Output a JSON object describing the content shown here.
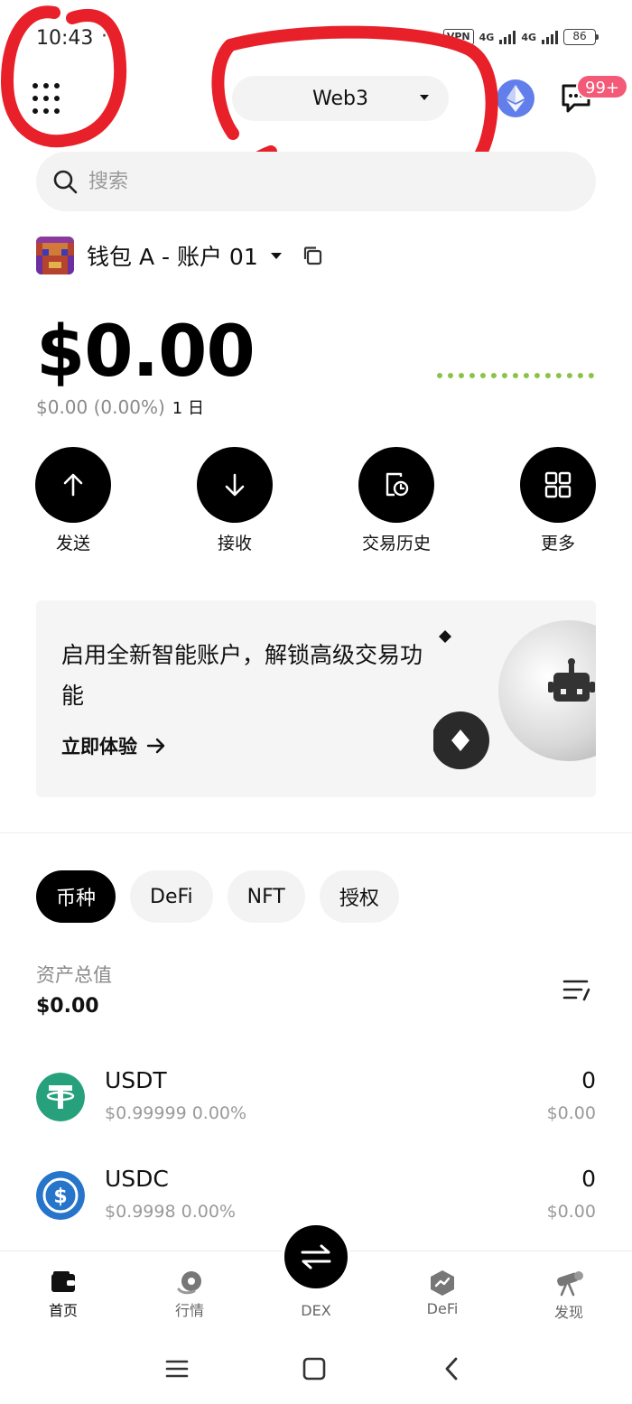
{
  "status_bar": {
    "time": "10:43",
    "dots": "···",
    "vpn": "VPN",
    "net1": "4G",
    "net2": "4G",
    "battery": "86"
  },
  "header": {
    "network_label": "Web3",
    "notification_badge": "99+"
  },
  "search": {
    "placeholder": "搜索"
  },
  "account": {
    "name": "钱包 A - 账户 01"
  },
  "balance": {
    "amount": "$0.00",
    "change": "$0.00 (0.00%)",
    "period": "1 日"
  },
  "actions": [
    {
      "label": "发送"
    },
    {
      "label": "接收"
    },
    {
      "label": "交易历史"
    },
    {
      "label": "更多"
    }
  ],
  "promo": {
    "text": "启用全新智能账户，解锁高级交易功能",
    "link": "立即体验"
  },
  "tabs": [
    {
      "label": "币种",
      "active": true
    },
    {
      "label": "DeFi",
      "active": false
    },
    {
      "label": "NFT",
      "active": false
    },
    {
      "label": "授权",
      "active": false
    }
  ],
  "assets": {
    "total_label": "资产总值",
    "total_value": "$0.00"
  },
  "tokens": [
    {
      "symbol": "USDT",
      "price_change": "$0.99999 0.00%",
      "quantity": "0",
      "value": "$0.00",
      "color": "#26a17b"
    },
    {
      "symbol": "USDC",
      "price_change": "$0.9998 0.00%",
      "quantity": "0",
      "value": "$0.00",
      "color": "#2775ca"
    }
  ],
  "bottom_nav": [
    {
      "label": "首页",
      "icon": "wallet-icon",
      "active": true
    },
    {
      "label": "行情",
      "icon": "market-icon",
      "active": false
    },
    {
      "label": "DEX",
      "icon": "swap-icon",
      "active": false
    },
    {
      "label": "DeFi",
      "icon": "defi-icon",
      "active": false
    },
    {
      "label": "发现",
      "icon": "telescope-icon",
      "active": false
    }
  ],
  "colors": {
    "accent": "#000000",
    "annotation": "#e8202a",
    "positive": "#8bc34a",
    "badge": "#f25a78",
    "eth": "#627eea"
  }
}
